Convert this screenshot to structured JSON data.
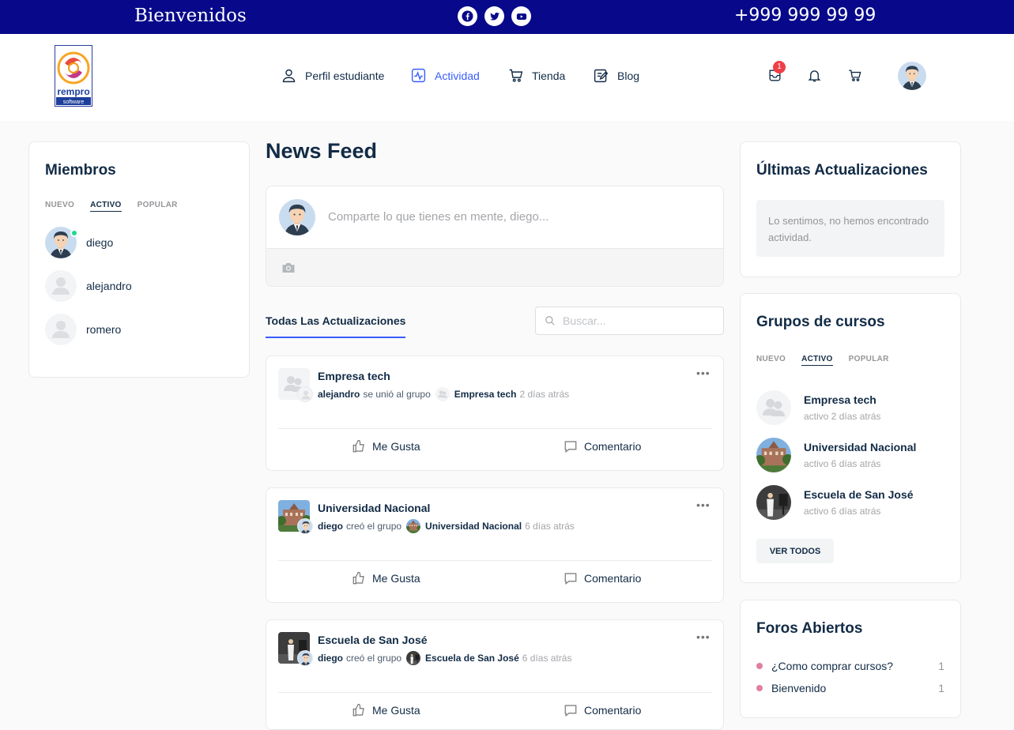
{
  "topbar": {
    "welcome": "Bienvenidos",
    "phone": "+999 999 99 99",
    "social": [
      "facebook-icon",
      "twitter-icon",
      "youtube-icon"
    ]
  },
  "brand": {
    "logo_text": "rempro",
    "logo_sub": "software"
  },
  "nav": {
    "items": [
      {
        "label": "Perfil estudiante",
        "icon": "user-icon"
      },
      {
        "label": "Actividad",
        "icon": "activity-icon"
      },
      {
        "label": "Tienda",
        "icon": "cart-icon"
      },
      {
        "label": "Blog",
        "icon": "edit-icon"
      }
    ],
    "messages_badge": "1"
  },
  "members": {
    "title": "Miembros",
    "tabs": [
      "NUEVO",
      "ACTIVO",
      "POPULAR"
    ],
    "list": [
      {
        "name": "diego"
      },
      {
        "name": "alejandro"
      },
      {
        "name": "romero"
      }
    ]
  },
  "feed": {
    "title": "News Feed",
    "placeholder": "Comparte lo que tienes en mente, diego...",
    "tab": "Todas Las Actualizaciones",
    "search_placeholder": "Buscar...",
    "like_label": "Me Gusta",
    "comment_label": "Comentario",
    "activities": [
      {
        "group": "Empresa tech",
        "user": "alejandro",
        "action": "se unió al grupo",
        "target": "Empresa tech",
        "time": "2 días atrás"
      },
      {
        "group": "Universidad Nacional",
        "user": "diego",
        "action": "creó el grupo",
        "target": "Universidad Nacional",
        "time": "6 días atrás"
      },
      {
        "group": "Escuela de San José",
        "user": "diego",
        "action": "creó el grupo",
        "target": "Escuela de San José",
        "time": "6 días atrás"
      }
    ]
  },
  "updates": {
    "title": "Últimas Actualizaciones",
    "empty": "Lo sentimos, no hemos encontrado actividad."
  },
  "groups": {
    "title": "Grupos de cursos",
    "tabs": [
      "NUEVO",
      "ACTIVO",
      "POPULAR"
    ],
    "list": [
      {
        "name": "Empresa tech",
        "status": "activo 2 días atrás"
      },
      {
        "name": "Universidad Nacional",
        "status": "activo 6 días atrás"
      },
      {
        "name": "Escuela de San José",
        "status": "activo 6 días atrás"
      }
    ],
    "view_all": "VER TODOS"
  },
  "forums": {
    "title": "Foros Abiertos",
    "list": [
      {
        "name": "¿Como comprar cursos?",
        "count": "1"
      },
      {
        "name": "Bienvenido",
        "count": "1"
      }
    ]
  },
  "colors": {
    "topbar": "#07098a",
    "accent": "#385dff",
    "online": "#1cd991",
    "badge": "#ef3e46",
    "forum_dot": "#e17fa0"
  }
}
